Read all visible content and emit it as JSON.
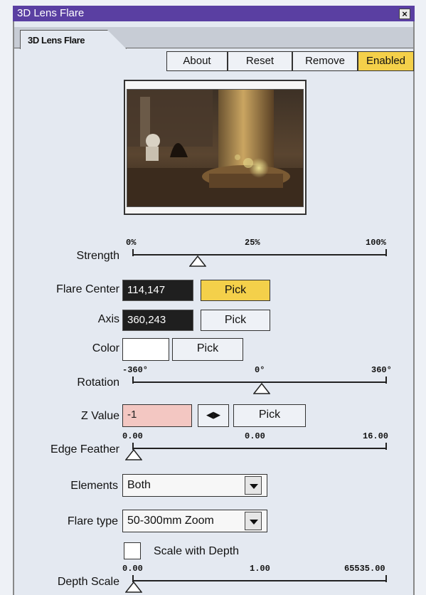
{
  "window": {
    "title": "3D Lens Flare",
    "close_glyph": "×"
  },
  "tab": {
    "label": "3D Lens Flare"
  },
  "toolbar": {
    "about": "About",
    "reset": "Reset",
    "remove": "Remove",
    "enabled": "Enabled"
  },
  "strength": {
    "label": "Strength",
    "min": "0%",
    "mid": "25%",
    "max": "100%",
    "value_percent": 25
  },
  "flare_center": {
    "label": "Flare Center",
    "value": "114,147",
    "pick": "Pick"
  },
  "axis": {
    "label": "Axis",
    "value": "360,243",
    "pick": "Pick"
  },
  "color": {
    "label": "Color",
    "pick": "Pick",
    "swatch": "#ffffff"
  },
  "rotation": {
    "label": "Rotation",
    "min": "-360°",
    "mid": "0°",
    "max": "360°",
    "value": 0
  },
  "z_value": {
    "label": "Z Value",
    "value": "-1",
    "arrows": "◀▶",
    "pick": "Pick"
  },
  "edge_feather": {
    "label": "Edge Feather",
    "min": "0.00",
    "mid": "0.00",
    "max": "16.00",
    "value": 0
  },
  "elements": {
    "label": "Elements",
    "value": "Both"
  },
  "flare_type": {
    "label": "Flare type",
    "value": "50-300mm Zoom"
  },
  "scale_with_depth": {
    "label": "Scale with Depth",
    "checked": false
  },
  "depth_scale": {
    "label": "Depth Scale",
    "min": "0.00",
    "mid": "1.00",
    "max": "65535.00",
    "value": 0
  }
}
